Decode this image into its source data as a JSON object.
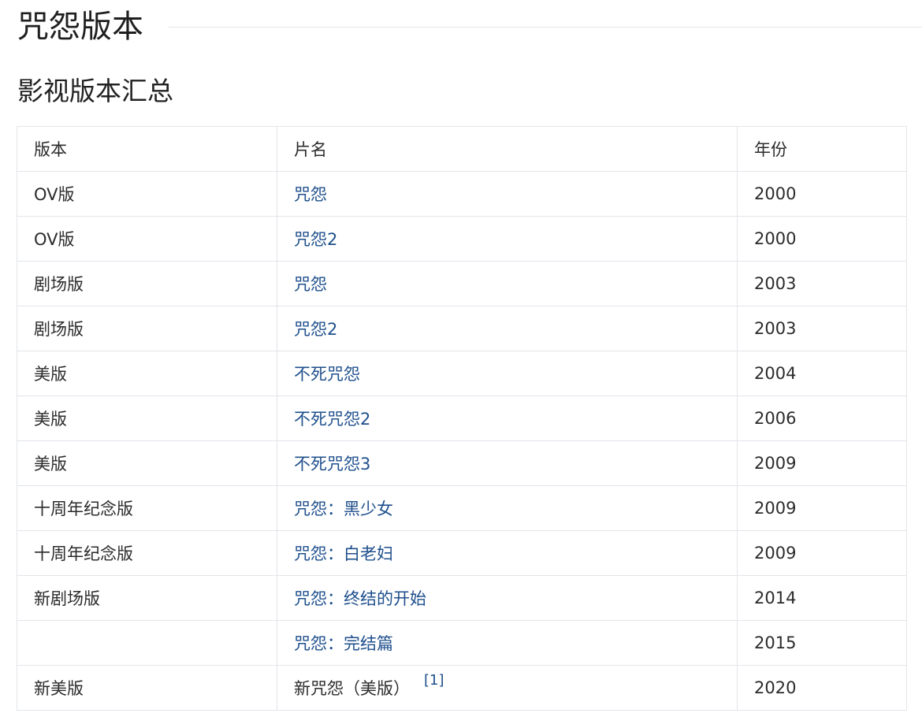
{
  "page_title": "咒怨版本",
  "section_title": "影视版本汇总",
  "table": {
    "headers": [
      "版本",
      "片名",
      "年份"
    ],
    "rows": [
      {
        "version": "OV版",
        "title": "咒怨",
        "year": "2000",
        "link": true
      },
      {
        "version": "OV版",
        "title": "咒怨2",
        "year": "2000",
        "link": true
      },
      {
        "version": "剧场版",
        "title": "咒怨",
        "year": "2003",
        "link": true
      },
      {
        "version": "剧场版",
        "title": "咒怨2",
        "year": "2003",
        "link": true
      },
      {
        "version": "美版",
        "title": "不死咒怨",
        "year": "2004",
        "link": true
      },
      {
        "version": "美版",
        "title": "不死咒怨2",
        "year": "2006",
        "link": true
      },
      {
        "version": "美版",
        "title": "不死咒怨3",
        "year": "2009",
        "link": true
      },
      {
        "version": "十周年纪念版",
        "title": "咒怨：黑少女",
        "year": "2009",
        "link": true
      },
      {
        "version": "十周年纪念版",
        "title": "咒怨：白老妇",
        "year": "2009",
        "link": true
      },
      {
        "version": "新剧场版",
        "title": "咒怨：终结的开始",
        "year": "2014",
        "link": true
      },
      {
        "version": "",
        "title": "咒怨：完结篇",
        "year": "2015",
        "link": true
      },
      {
        "version": "新美版",
        "title": "新咒怨（美版）",
        "year": "2020",
        "link": false,
        "ref": "[1]"
      }
    ]
  },
  "colors": {
    "link": "#1e4f8c",
    "text": "#2b2b2b",
    "border": "#e3e5ea"
  }
}
